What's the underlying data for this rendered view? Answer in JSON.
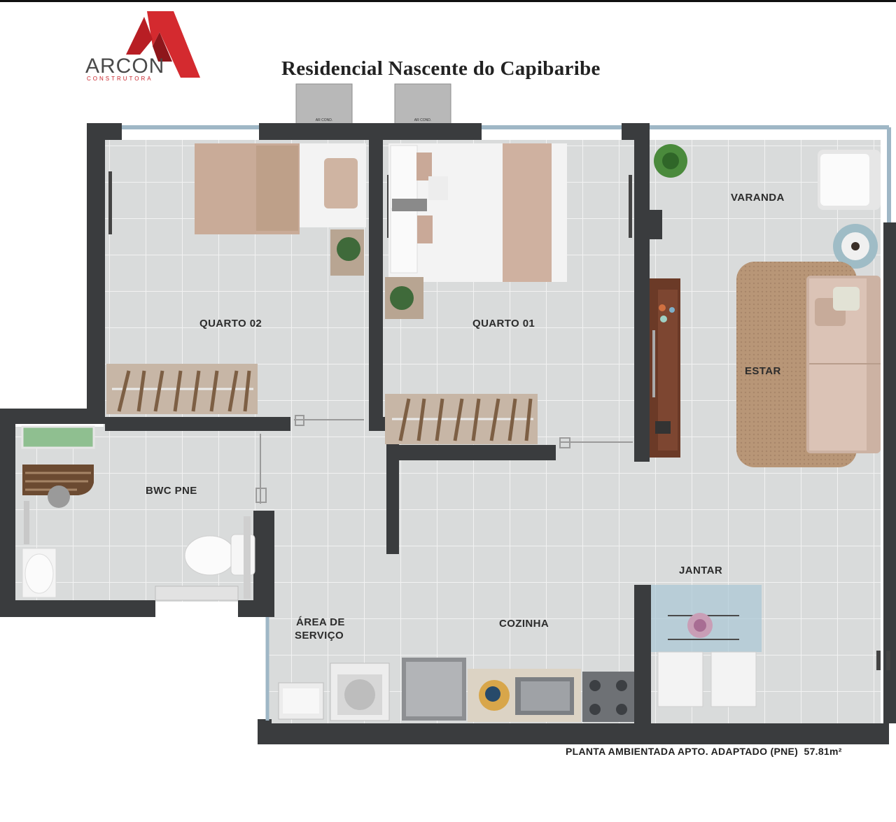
{
  "header": {
    "brand_name": "ARCON",
    "brand_sub": "CONSTRUTORA",
    "title": "Residencial Nascente do Capibaribe"
  },
  "rooms": {
    "quarto02": "QUARTO 02",
    "quarto01": "QUARTO 01",
    "varanda": "VARANDA",
    "estar": "ESTAR",
    "bwc": "BWC PNE",
    "jantar": "JANTAR",
    "area_servico_line1": "ÁREA DE",
    "area_servico_line2": "SERVIÇO",
    "cozinha": "COZINHA"
  },
  "ac_labels": [
    "AR COND.",
    "AR COND."
  ],
  "caption": {
    "text": "PLANTA AMBIENTADA APTO. ADAPTADO (PNE)",
    "area": "57.81m²"
  },
  "colors": {
    "brand_red": "#c8232a",
    "wall": "#3a3c3e",
    "floor": "#d6d8d8",
    "grid": "#eeeeee"
  }
}
